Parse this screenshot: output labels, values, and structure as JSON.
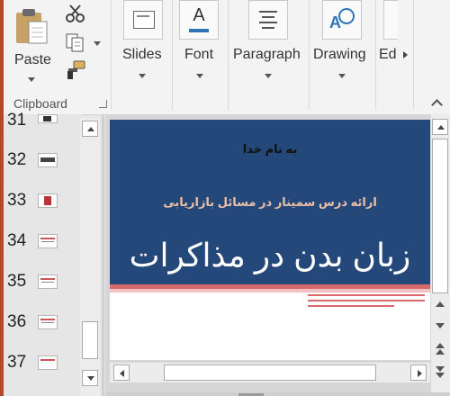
{
  "ribbon": {
    "clipboard_group": {
      "paste_label": "Paste",
      "group_label": "Clipboard"
    },
    "slides_label": "Slides",
    "font_label": "Font",
    "paragraph_label": "Paragraph",
    "drawing_label": "Drawing",
    "editing_label": "Ed"
  },
  "thumbnails": {
    "numbers": [
      "31",
      "32",
      "33",
      "34",
      "35",
      "36",
      "37"
    ]
  },
  "slide": {
    "header": "به نام خدا",
    "subtitle": "ارائه درس سمینار در مسائل بازاریابی",
    "title": "زبان بدن در مذاکرات"
  },
  "colors": {
    "accent": "#b7472a",
    "slide_background": "#234879",
    "stripe": "#d9696b",
    "font_a_underline": "#2e75b6"
  }
}
